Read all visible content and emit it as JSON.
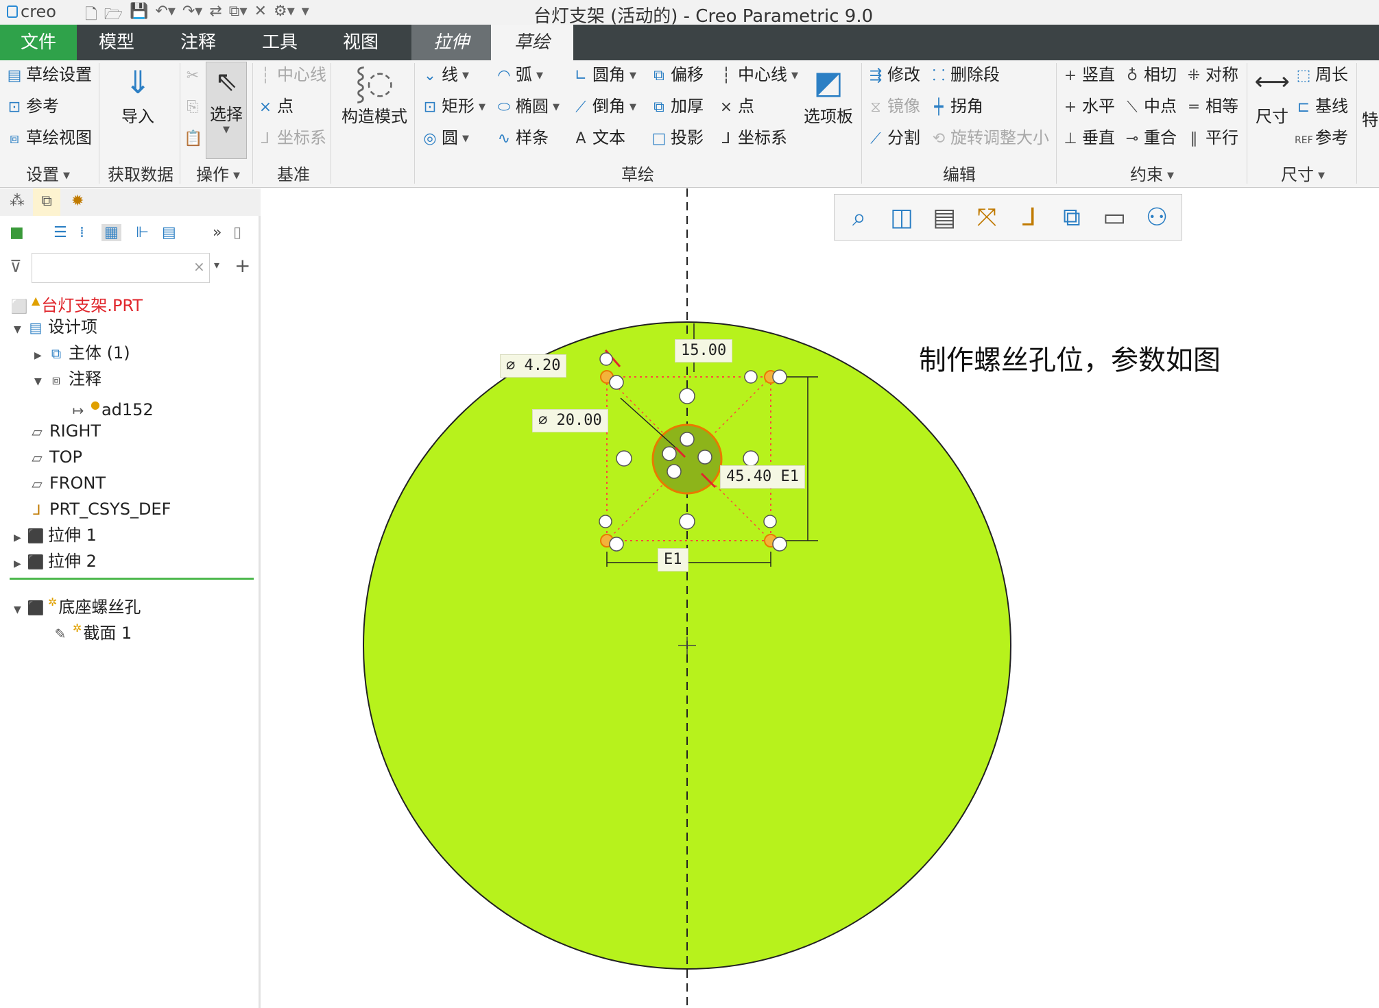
{
  "title_bar": {
    "brand": "creo",
    "window_title": "台灯支架 (活动的) - Creo Parametric 9.0"
  },
  "tabs": {
    "file": "文件",
    "model": "模型",
    "annotate": "注释",
    "tools": "工具",
    "view": "视图",
    "extrude": "拉伸",
    "sketch": "草绘"
  },
  "ribbon": {
    "setup": {
      "sketch_setup": "草绘设置",
      "references": "参考",
      "sketch_view": "草绘视图",
      "group": "设置"
    },
    "get_data": {
      "import": "导入",
      "group": "获取数据"
    },
    "operations": {
      "select": "选择",
      "group": "操作"
    },
    "datum": {
      "centerline": "中心线",
      "point": "点",
      "csys": "坐标系",
      "group": "基准"
    },
    "construction": {
      "label": "构造模式"
    },
    "sketching": {
      "line": "线",
      "rectangle": "矩形",
      "circle": "圆",
      "arc": "弧",
      "ellipse": "椭圆",
      "spline": "样条",
      "fillet": "圆角",
      "chamfer": "倒角",
      "text": "文本",
      "offset": "偏移",
      "thicken": "加厚",
      "project": "投影",
      "centerline": "中心线",
      "point": "点",
      "csys": "坐标系",
      "palette": "选项板",
      "group": "草绘"
    },
    "editing": {
      "modify": "修改",
      "delete_segment": "删除段",
      "mirror": "镜像",
      "corner": "拐角",
      "divide": "分割",
      "rotate_resize": "旋转调整大小",
      "group": "编辑"
    },
    "constrain": {
      "vertical": "竖直",
      "tangent": "相切",
      "symmetric": "对称",
      "horizontal": "水平",
      "midpoint": "中点",
      "equal": "相等",
      "perpendicular": "垂直",
      "coincident": "重合",
      "parallel": "平行",
      "group": "约束"
    },
    "dimension": {
      "dimension": "尺寸",
      "perimeter": "周长",
      "baseline": "基线",
      "reference": "参考",
      "group": "尺寸"
    },
    "overflow": "特"
  },
  "tree": {
    "search_placeholder": "",
    "items": [
      {
        "label": "台灯支架.PRT"
      },
      {
        "label": "设计项"
      },
      {
        "label": "主体 (1)"
      },
      {
        "label": "注释"
      },
      {
        "label": "ad152"
      },
      {
        "label": "RIGHT"
      },
      {
        "label": "TOP"
      },
      {
        "label": "FRONT"
      },
      {
        "label": "PRT_CSYS_DEF"
      },
      {
        "label": "拉伸 1"
      },
      {
        "label": "拉伸 2"
      },
      {
        "label": "底座螺丝孔"
      },
      {
        "label": "截面 1"
      }
    ]
  },
  "canvas": {
    "note": "制作螺丝孔位，参数如图",
    "dimensions": {
      "small_hole_dia": "∅ 4.20",
      "top_offset": "15.00",
      "center_hole_dia": "∅ 20.00",
      "square_height": "45.40  E1",
      "square_width": "E1"
    },
    "colors": {
      "face": "#b7f21c",
      "center_hole_fill": "#8db41a",
      "constraint": "#e87a00",
      "dimension": "#e0262c"
    }
  }
}
